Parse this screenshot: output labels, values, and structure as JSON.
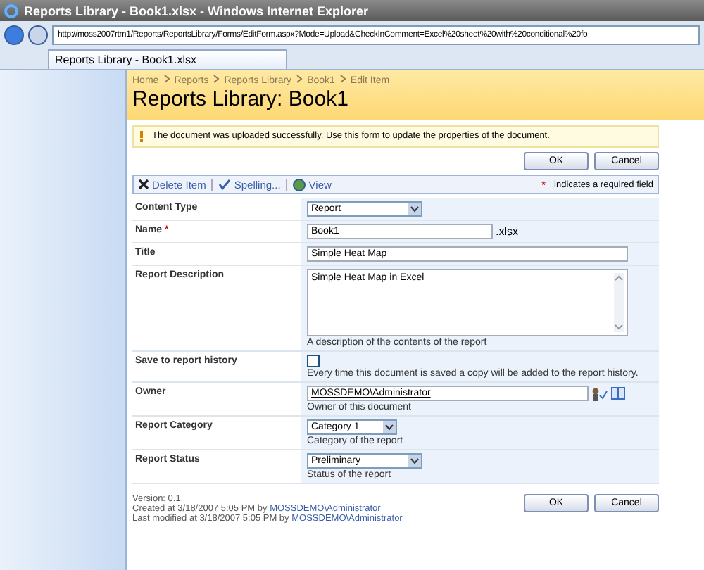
{
  "window": {
    "title": "Reports Library - Book1.xlsx - Windows Internet Explorer"
  },
  "browser": {
    "address": "http://moss2007rtm1/Reports/ReportsLibrary/Forms/EditForm.aspx?Mode=Upload&CheckInComment=Excel%20sheet%20with%20conditional%20fo",
    "tab": "Reports Library - Book1.xlsx"
  },
  "breadcrumb": [
    "Home",
    "Reports",
    "Reports Library",
    "Book1",
    "Edit Item"
  ],
  "page_title": "Reports Library: Book1",
  "message": "The document was uploaded successfully. Use this form to update the properties of the document.",
  "top_buttons": [
    "OK",
    "Cancel"
  ],
  "toolbar": {
    "items": [
      {
        "kind": "delete",
        "label": "Delete Item"
      },
      {
        "kind": "spelling",
        "label": "Spelling..."
      },
      {
        "kind": "view",
        "label": "View"
      }
    ],
    "required_mark": "*",
    "required_note": "indicates a required field"
  },
  "fields": [
    {
      "kind": "select",
      "label": "Content Type",
      "value": "Report"
    },
    {
      "kind": "text",
      "label": "Name",
      "required_mark": "*",
      "value": "Book1",
      "suffix": ".xlsx"
    },
    {
      "kind": "text",
      "label": "Title",
      "value": "Simple Heat Map"
    },
    {
      "kind": "textarea",
      "label": "Report Description",
      "value": "Simple Heat Map in Excel",
      "hint": "A description of the contents of the report"
    },
    {
      "kind": "checkbox",
      "label": "Save to report history",
      "checked": false,
      "hint": "Every time this document is saved a copy will be added to the report history."
    },
    {
      "kind": "people",
      "label": "Owner",
      "value": "MOSSDEMO\\Administrator",
      "hint": "Owner of this document"
    },
    {
      "kind": "select",
      "label": "Report Category",
      "value": "Category 1",
      "hint": "Category of the report"
    },
    {
      "kind": "select",
      "label": "Report Status",
      "value": "Preliminary",
      "hint": "Status of the report"
    }
  ],
  "footer": {
    "version": "Version: 0.1",
    "created": "Created at 3/18/2007 5:05 PM  by",
    "created_by": "MOSSDEMO\\Administrator",
    "modified": "Last modified at 3/18/2007 5:05 PM  by",
    "modified_by": "MOSSDEMO\\Administrator"
  },
  "bottom_buttons": [
    "OK",
    "Cancel"
  ]
}
